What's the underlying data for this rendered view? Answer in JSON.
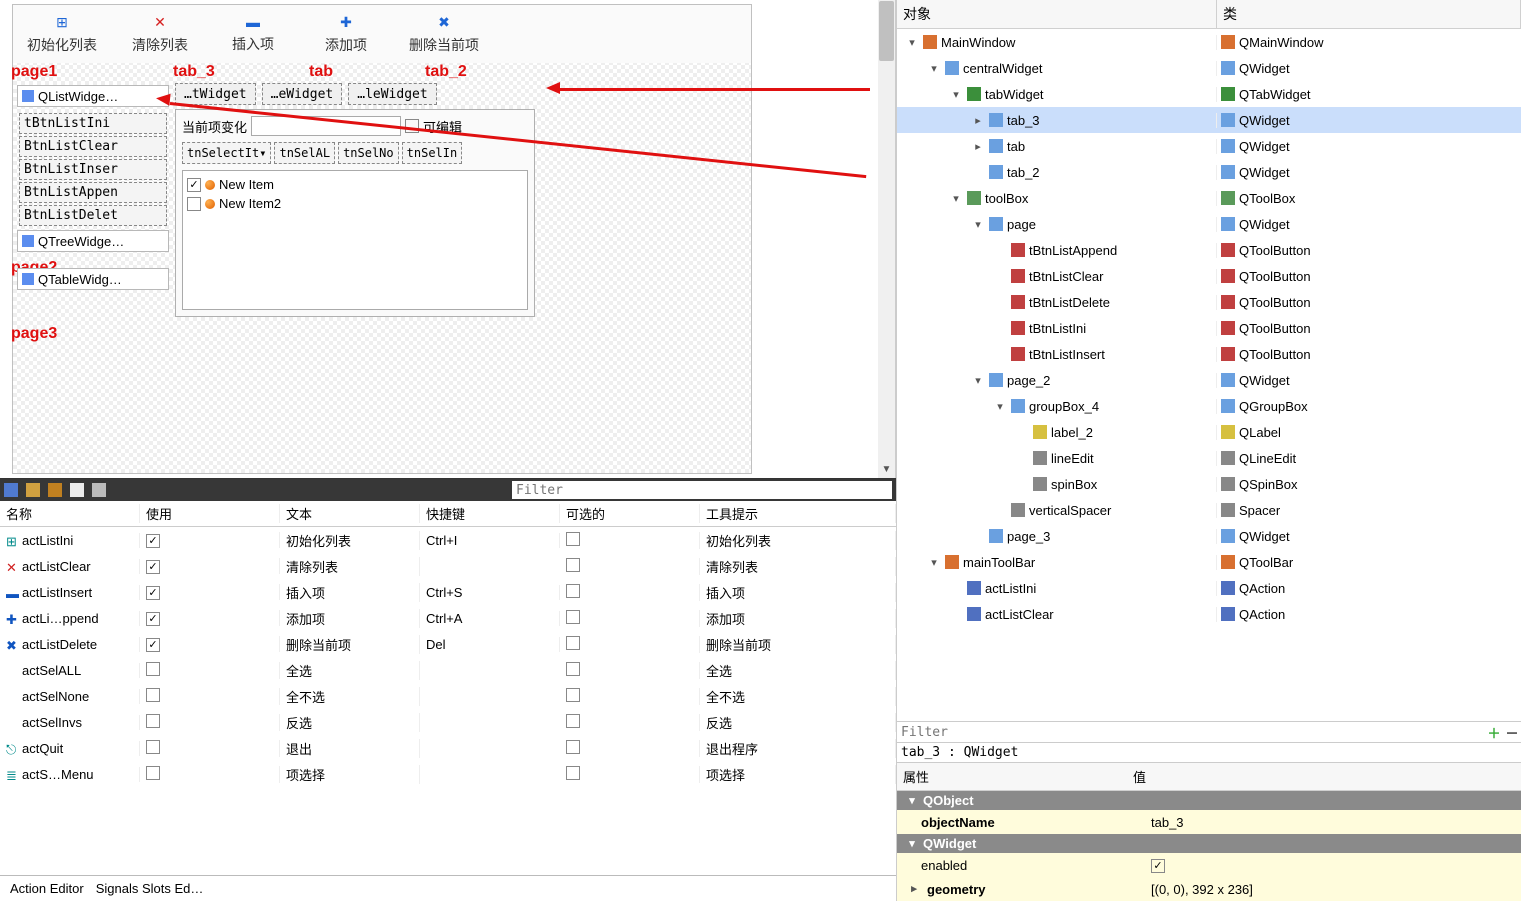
{
  "toolbar": [
    {
      "icon": "⊞",
      "iconClass": "blue",
      "label": "初始化列表"
    },
    {
      "icon": "✕",
      "iconClass": "red",
      "label": "清除列表"
    },
    {
      "icon": "▬",
      "iconClass": "blue",
      "label": "插入项"
    },
    {
      "icon": "✚",
      "iconClass": "blue",
      "label": "添加项"
    },
    {
      "icon": "✖",
      "iconClass": "blue",
      "label": "删除当前项"
    }
  ],
  "annotations": {
    "page1": "page1",
    "page2": "page2",
    "page3": "page3",
    "tab3": "tab_3",
    "tab": "tab",
    "tab2": "tab_2"
  },
  "toolbox": {
    "page1": "QListWidge…",
    "btns": [
      "tBtnListIni",
      "BtnListClear",
      "BtnListInser",
      "BtnListAppen",
      "BtnListDelet"
    ],
    "page2": "QTreeWidge…",
    "page3": "QTableWidg…"
  },
  "tabs": [
    "…tWidget",
    "…eWidget",
    "…leWidget"
  ],
  "fieldLabel": "当前项变化",
  "editableLabel": "可编辑",
  "selBtns": [
    "tnSelectIt▾",
    "tnSelAL",
    "tnSelNo",
    "tnSelIn"
  ],
  "listItems": [
    {
      "checked": true,
      "text": "New Item"
    },
    {
      "checked": false,
      "text": "New Item2"
    }
  ],
  "inspector": {
    "head": [
      "对象",
      "类"
    ],
    "rows": [
      {
        "d": 0,
        "t": "▾",
        "i": "win",
        "n": "MainWindow",
        "c": "QMainWindow"
      },
      {
        "d": 1,
        "t": "▾",
        "i": "wid",
        "n": "centralWidget",
        "c": "QWidget"
      },
      {
        "d": 2,
        "t": "▾",
        "i": "tab",
        "n": "tabWidget",
        "c": "QTabWidget"
      },
      {
        "d": 3,
        "t": "▸",
        "i": "wid",
        "n": "tab_3",
        "c": "QWidget",
        "sel": true
      },
      {
        "d": 3,
        "t": "▸",
        "i": "wid",
        "n": "tab",
        "c": "QWidget"
      },
      {
        "d": 3,
        "t": "",
        "i": "wid",
        "n": "tab_2",
        "c": "QWidget"
      },
      {
        "d": 2,
        "t": "▾",
        "i": "box",
        "n": "toolBox",
        "c": "QToolBox"
      },
      {
        "d": 3,
        "t": "▾",
        "i": "wid",
        "n": "page",
        "c": "QWidget"
      },
      {
        "d": 4,
        "t": "",
        "i": "tool",
        "n": "tBtnListAppend",
        "c": "QToolButton"
      },
      {
        "d": 4,
        "t": "",
        "i": "tool",
        "n": "tBtnListClear",
        "c": "QToolButton"
      },
      {
        "d": 4,
        "t": "",
        "i": "tool",
        "n": "tBtnListDelete",
        "c": "QToolButton"
      },
      {
        "d": 4,
        "t": "",
        "i": "tool",
        "n": "tBtnListIni",
        "c": "QToolButton"
      },
      {
        "d": 4,
        "t": "",
        "i": "tool",
        "n": "tBtnListInsert",
        "c": "QToolButton"
      },
      {
        "d": 3,
        "t": "▾",
        "i": "wid",
        "n": "page_2",
        "c": "QWidget"
      },
      {
        "d": 4,
        "t": "▾",
        "i": "wid",
        "n": "groupBox_4",
        "c": "QGroupBox"
      },
      {
        "d": 5,
        "t": "",
        "i": "lbl",
        "n": "label_2",
        "c": "QLabel"
      },
      {
        "d": 5,
        "t": "",
        "i": "edit",
        "n": "lineEdit",
        "c": "QLineEdit"
      },
      {
        "d": 5,
        "t": "",
        "i": "edit",
        "n": "spinBox",
        "c": "QSpinBox"
      },
      {
        "d": 4,
        "t": "",
        "i": "edit",
        "n": "verticalSpacer",
        "c": "Spacer"
      },
      {
        "d": 3,
        "t": "",
        "i": "wid",
        "n": "page_3",
        "c": "QWidget"
      },
      {
        "d": 1,
        "t": "▾",
        "i": "win",
        "n": "mainToolBar",
        "c": "QToolBar"
      },
      {
        "d": 2,
        "t": "",
        "i": "act",
        "n": "actListIni",
        "c": "QAction"
      },
      {
        "d": 2,
        "t": "",
        "i": "act",
        "n": "actListClear",
        "c": "QAction"
      }
    ]
  },
  "propFilter": "Filter",
  "propPath": "tab_3 : QWidget",
  "propHead": [
    "属性",
    "值"
  ],
  "propGroups": [
    {
      "name": "QObject",
      "rows": [
        {
          "k": "objectName",
          "v": "tab_3",
          "bold": true
        }
      ]
    },
    {
      "name": "QWidget",
      "rows": [
        {
          "k": "enabled",
          "v": "",
          "cb": true
        },
        {
          "k": "geometry",
          "v": "[(0, 0), 392 x 236]",
          "bold": true,
          "expand": true
        }
      ]
    }
  ],
  "actions": {
    "filter": "Filter",
    "head": [
      "名称",
      "使用",
      "文本",
      "快捷键",
      "可选的",
      "工具提示"
    ],
    "rows": [
      {
        "icon": "⊞",
        "ic": "teal",
        "name": "actListIni",
        "use": true,
        "text": "初始化列表",
        "sc": "Ctrl+I",
        "opt": false,
        "tip": "初始化列表"
      },
      {
        "icon": "✕",
        "ic": "red",
        "name": "actListClear",
        "use": true,
        "text": "清除列表",
        "sc": "",
        "opt": false,
        "tip": "清除列表"
      },
      {
        "icon": "▬",
        "ic": "blue",
        "name": "actListInsert",
        "use": true,
        "text": "插入项",
        "sc": "Ctrl+S",
        "opt": false,
        "tip": "插入项"
      },
      {
        "icon": "✚",
        "ic": "blue",
        "name": "actLi…ppend",
        "use": true,
        "text": "添加项",
        "sc": "Ctrl+A",
        "opt": false,
        "tip": "添加项"
      },
      {
        "icon": "✖",
        "ic": "blue",
        "name": "actListDelete",
        "use": true,
        "text": "删除当前项",
        "sc": "Del",
        "opt": false,
        "tip": "删除当前项"
      },
      {
        "icon": "",
        "ic": "",
        "name": "actSelALL",
        "use": false,
        "text": "全选",
        "sc": "",
        "opt": false,
        "tip": "全选"
      },
      {
        "icon": "",
        "ic": "",
        "name": "actSelNone",
        "use": false,
        "text": "全不选",
        "sc": "",
        "opt": false,
        "tip": "全不选"
      },
      {
        "icon": "",
        "ic": "",
        "name": "actSelInvs",
        "use": false,
        "text": "反选",
        "sc": "",
        "opt": false,
        "tip": "反选"
      },
      {
        "icon": "⎋",
        "ic": "teal",
        "name": "actQuit",
        "use": false,
        "text": "退出",
        "sc": "",
        "opt": false,
        "tip": "退出程序"
      },
      {
        "icon": "≣",
        "ic": "teal",
        "name": "actS…Menu",
        "use": false,
        "text": "项选择",
        "sc": "",
        "opt": false,
        "tip": "项选择"
      }
    ],
    "tabs": [
      "Action Editor",
      "Signals Slots Ed…"
    ]
  }
}
